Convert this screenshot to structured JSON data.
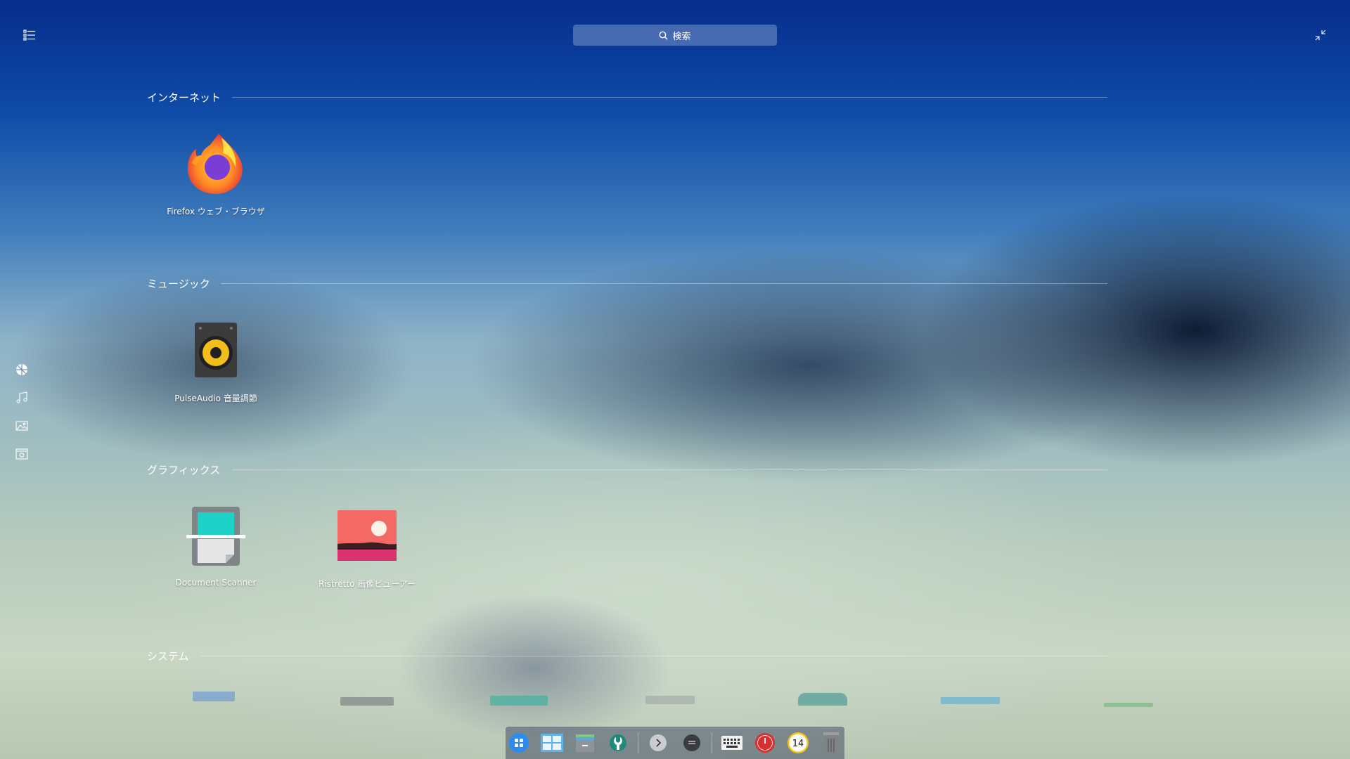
{
  "header": {
    "search_placeholder": "検索"
  },
  "sections": [
    {
      "title": "インターネット",
      "apps": [
        {
          "label": "Firefox ウェブ・ブラウザ",
          "icon": "firefox-icon"
        }
      ]
    },
    {
      "title": "ミュージック",
      "apps": [
        {
          "label": "PulseAudio 音量調節",
          "icon": "speaker-icon"
        }
      ]
    },
    {
      "title": "グラフィックス",
      "apps": [
        {
          "label": "Document Scanner",
          "icon": "scanner-icon"
        },
        {
          "label": "Ristretto 画像ビューアー",
          "icon": "image-viewer-icon"
        }
      ]
    },
    {
      "title": "システム",
      "apps": []
    }
  ],
  "side_nav": [
    "internet-icon",
    "music-icon",
    "image-icon",
    "system-icon"
  ],
  "dock": {
    "items": [
      "launcher-icon",
      "multitask-view-icon",
      "file-manager-icon",
      "settings-wrench-icon",
      "expand-arrow-icon",
      "tray-icon",
      "keyboard-icon",
      "power-icon",
      "clock-icon",
      "trash-icon"
    ],
    "clock_text": "14"
  },
  "colors": {
    "accent_blue": "#2b8cf0",
    "power_red": "#d9302f",
    "clock_yellow": "#f4c21b"
  }
}
